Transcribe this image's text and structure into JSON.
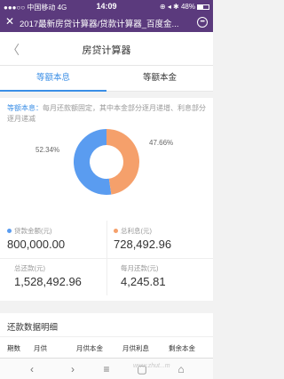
{
  "status_bar": {
    "carrier": "●●●○○ 中国移动  4G",
    "time": "14:09",
    "right": "⊕ ◂ ✱ 48%"
  },
  "title_bar": {
    "title": "2017最新房贷计算器/贷款计算器_百度金...",
    "close_glyph": "✕",
    "more_glyph": "•••"
  },
  "nav": {
    "back_glyph": "〈",
    "title": "房贷计算器"
  },
  "tabs": [
    {
      "label": "等额本息",
      "active": true
    },
    {
      "label": "等额本金",
      "active": false
    }
  ],
  "description": {
    "key": "等额本息：",
    "text": "每月还款额固定，其中本金部分逐月递增、利息部分逐月递减"
  },
  "chart_data": {
    "type": "pie",
    "categories": [
      "贷款金额",
      "总利息"
    ],
    "values": [
      52.34,
      47.66
    ],
    "labels": [
      "52.34%",
      "47.66%"
    ],
    "colors": [
      "#5a9cf0",
      "#f5a06b"
    ]
  },
  "stats": {
    "loan_label": "贷款金额(元)",
    "loan_value": "800,000.00",
    "interest_label": "总利息(元)",
    "interest_value": "728,492.96",
    "total_label": "总还款(元)",
    "total_value": "1,528,492.96",
    "monthly_label": "每月还款(元)",
    "monthly_value": "4,245.81"
  },
  "schedule": {
    "title": "还款数据明细",
    "columns": [
      "期数",
      "月供",
      "月供本金",
      "月供利息",
      "剩余本金"
    ]
  },
  "bottom_bar": {
    "back": "‹",
    "forward": "›",
    "menu": "≡",
    "windows": "▢",
    "home": "⌂"
  },
  "watermark": "www.zhut...m"
}
